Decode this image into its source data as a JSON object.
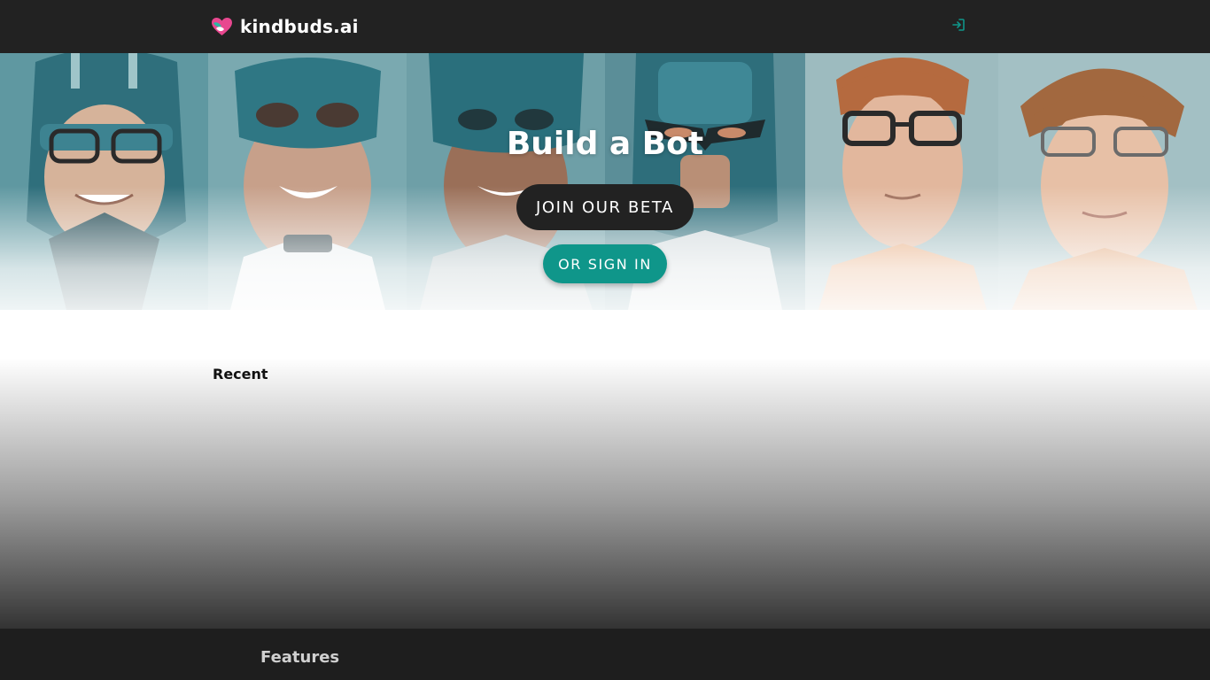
{
  "brand": {
    "name": "kindbuds.ai",
    "logo_icon": "heart-logo-icon",
    "logo_colors": [
      "#e8478f",
      "#ffffff",
      "#2ab8a4"
    ]
  },
  "header": {
    "signin_icon": "sign-in-icon",
    "accent": "#0f968a"
  },
  "hero": {
    "title": "Build a Bot",
    "primary_button": "JOIN OUR BETA",
    "secondary_button": "OR SIGN IN",
    "portrait_icons": [
      "robot-helmet-portrait",
      "masked-hero-portrait",
      "masked-hero-portrait",
      "armored-helmet-portrait",
      "glasses-man-portrait",
      "glasses-man-portrait"
    ]
  },
  "sections": {
    "recent": "Recent",
    "features": "Features"
  },
  "colors": {
    "topbar": "#222222",
    "teal": "#0f968a",
    "dark_button": "#222222"
  }
}
